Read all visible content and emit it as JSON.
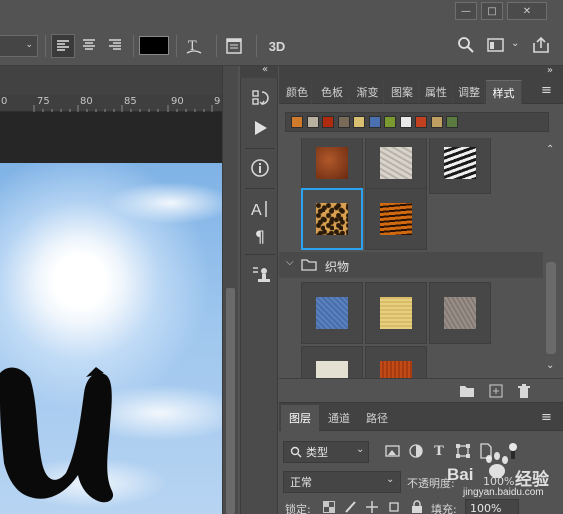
{
  "window": {
    "buttons": [
      {
        "label": "—"
      },
      {
        "label": "□"
      },
      {
        "label": "✕"
      }
    ]
  },
  "options_bar": {
    "color_swatch": "#000000",
    "label_3d": "3D"
  },
  "ruler": {
    "ticks": [
      "0",
      "75",
      "80",
      "85",
      "90",
      "9"
    ]
  },
  "styles_panel": {
    "collapse_left": "«",
    "collapse_right": "»",
    "tabs": [
      "颜色",
      "色板",
      "渐变",
      "图案",
      "属性",
      "调整",
      "样式"
    ],
    "active_tab": "样式",
    "menu": "≡",
    "group_name": "织物",
    "mini_swatches": [
      "#d07a2c",
      "#b8b0a0",
      "#b02a10",
      "#7a6a5a",
      "#d8c070",
      "#4a70b0",
      "#7a9a30",
      "#e8e8e8",
      "#c04020",
      "#c0a060",
      "#5a7a40"
    ]
  },
  "layers_panel": {
    "tabs": [
      "图层",
      "通道",
      "路径"
    ],
    "active_tab": "图层",
    "filter_label": "类型",
    "blend_mode": "正常",
    "opacity_label": "不透明度:",
    "opacity_value": "100%",
    "lock_label": "锁定:",
    "fill_label": "填充:",
    "fill_value": "100%"
  },
  "watermark": {
    "logo": "Bai",
    "brand_cn": "经验",
    "url": "jingyan.baidu.com"
  },
  "colors": {
    "accent_selected": "#2aa4ef",
    "panel_bg": "#535353"
  }
}
